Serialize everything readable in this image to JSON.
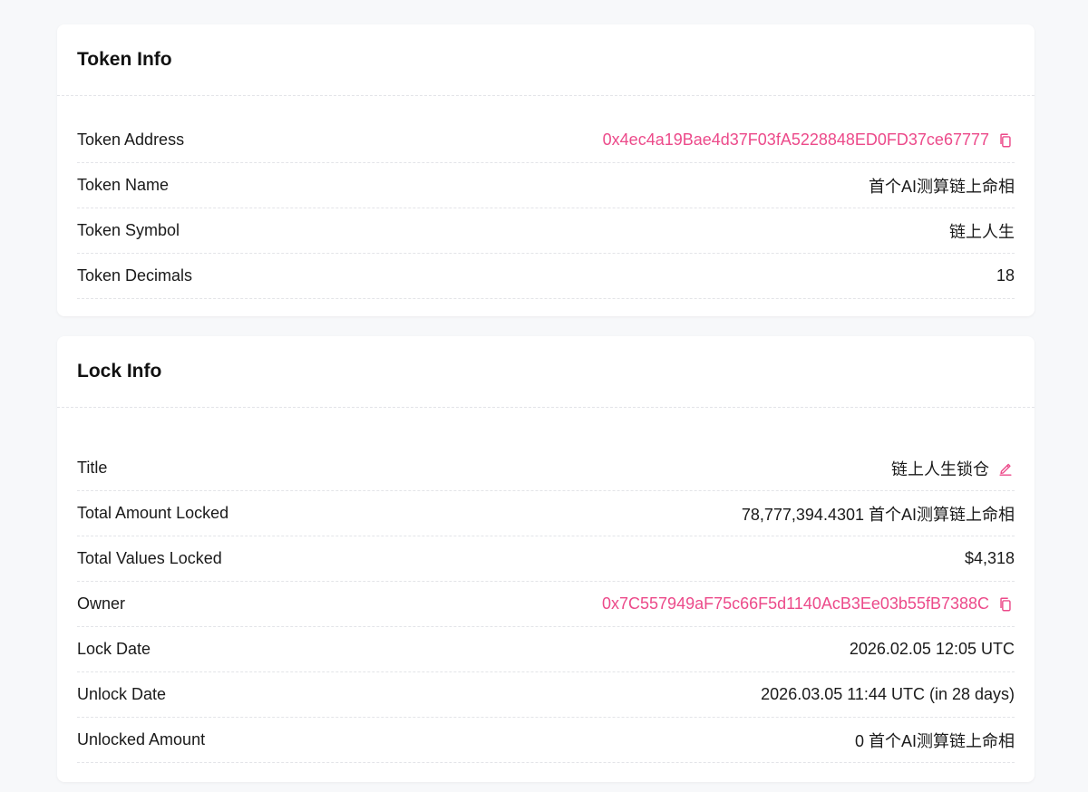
{
  "token_info": {
    "title": "Token Info",
    "rows": [
      {
        "label": "Token Address",
        "value": "0x4ec4a19Bae4d37F03fA5228848ED0FD37ce67777",
        "icon": "copy-icon"
      },
      {
        "label": "Token Name",
        "value": "首个AI测算链上命相"
      },
      {
        "label": "Token Symbol",
        "value": "链上人生"
      },
      {
        "label": "Token Decimals",
        "value": "18"
      }
    ]
  },
  "lock_info": {
    "title": "Lock Info",
    "rows": [
      {
        "label": "Title",
        "value": "链上人生锁仓",
        "icon": "edit-icon"
      },
      {
        "label": "Total Amount Locked",
        "value": "78,777,394.4301 首个AI测算链上命相"
      },
      {
        "label": "Total Values Locked",
        "value": "$4,318"
      },
      {
        "label": "Owner",
        "value": "0x7C557949aF75c66F5d1140AcB3Ee03b55fB7388C",
        "icon": "copy-icon"
      },
      {
        "label": "Lock Date",
        "value": "2026.02.05 12:05 UTC"
      },
      {
        "label": "Unlock Date",
        "value": "2026.03.05 11:44 UTC (in 28 days)"
      },
      {
        "label": "Unlocked Amount",
        "value": "0 首个AI测算链上命相"
      }
    ]
  },
  "colors": {
    "accent": "#ec4a8a",
    "background": "#f7f8fa",
    "card": "#ffffff"
  }
}
